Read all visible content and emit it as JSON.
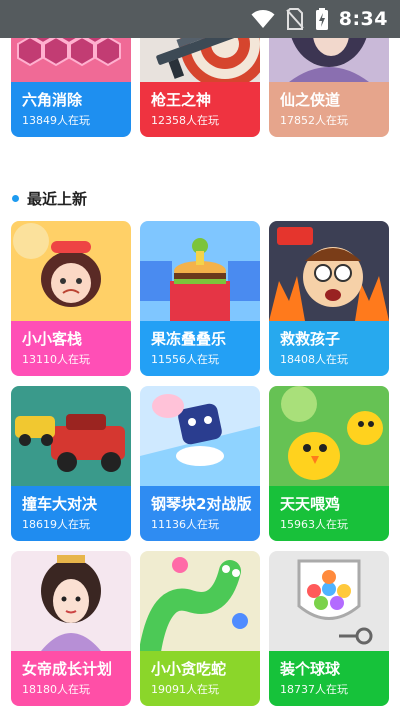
{
  "status_bar": {
    "time": "8:34"
  },
  "section": {
    "title": "最近上新"
  },
  "top_games": [
    {
      "name": "六角消除",
      "plays": "13849人在玩",
      "color": "#1e8ff0",
      "art": "hex"
    },
    {
      "name": "枪王之神",
      "plays": "12358人在玩",
      "color": "#ef3340",
      "art": "target"
    },
    {
      "name": "仙之侠道",
      "plays": "17852人在玩",
      "color": "#e6a58c",
      "art": "fantasy"
    }
  ],
  "games": [
    {
      "name": "小小客栈",
      "plays": "13110人在玩",
      "color": "#ff4fb6",
      "art": "girl"
    },
    {
      "name": "果冻叠叠乐",
      "plays": "11556人在玩",
      "color": "#23a0f5",
      "art": "burger"
    },
    {
      "name": "救救孩子",
      "plays": "18408人在玩",
      "color": "#27a9ee",
      "art": "help"
    },
    {
      "name": "撞车大对决",
      "plays": "18619人在玩",
      "color": "#1f8cf0",
      "art": "cars"
    },
    {
      "name": "钢琴块2对战版",
      "plays": "11136人在玩",
      "color": "#2f8cf2",
      "art": "piano"
    },
    {
      "name": "天天喂鸡",
      "plays": "15963人在玩",
      "color": "#18c13a",
      "art": "chicks"
    },
    {
      "name": "女帝成长计划",
      "plays": "18180人在玩",
      "color": "#ff4fa7",
      "art": "empress"
    },
    {
      "name": "小小贪吃蛇",
      "plays": "19091人在玩",
      "color": "#8bd62a",
      "art": "snake"
    },
    {
      "name": "装个球球",
      "plays": "18737人在玩",
      "color": "#16c23a",
      "art": "balls"
    }
  ]
}
